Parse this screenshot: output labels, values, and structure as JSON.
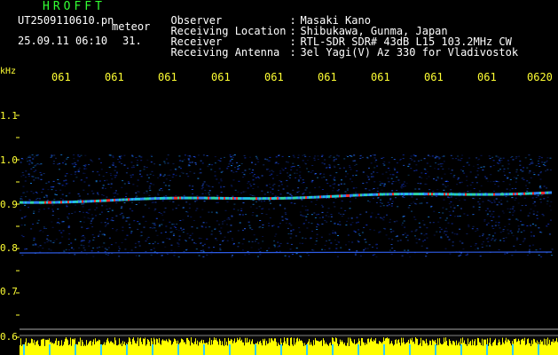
{
  "header": {
    "brand": "HROFFT",
    "filename": "UT2509110610.pn",
    "meteor_label": "meteor",
    "datetime": "25.09.11 06:10",
    "count": "31."
  },
  "meta": [
    {
      "key": "Observer",
      "value": "Masaki Kano"
    },
    {
      "key": "Receiving Location",
      "value": "Shibukawa, Gunma, Japan"
    },
    {
      "key": "Receiver",
      "value": "RTL-SDR SDR# 43dB L15 103.2MHz CW"
    },
    {
      "key": "Receiving Antenna",
      "value": "3el Yagi(V) Az 330 for Vladivostok"
    }
  ],
  "axis": {
    "unit": "kHz",
    "x_ticks": [
      "061",
      "061",
      "061",
      "061",
      "061",
      "061",
      "061",
      "061",
      "061",
      "0620"
    ],
    "y_ticks": [
      "1.1",
      "1.0",
      "0.9",
      "0.8",
      "0.7",
      "0.6"
    ]
  },
  "colors": {
    "brand": "#33ff33",
    "axis_text": "#ffff33",
    "noise_blue": "#1133cc",
    "signal_red": "#ff3333",
    "bottom_band": "#ffff00"
  }
}
